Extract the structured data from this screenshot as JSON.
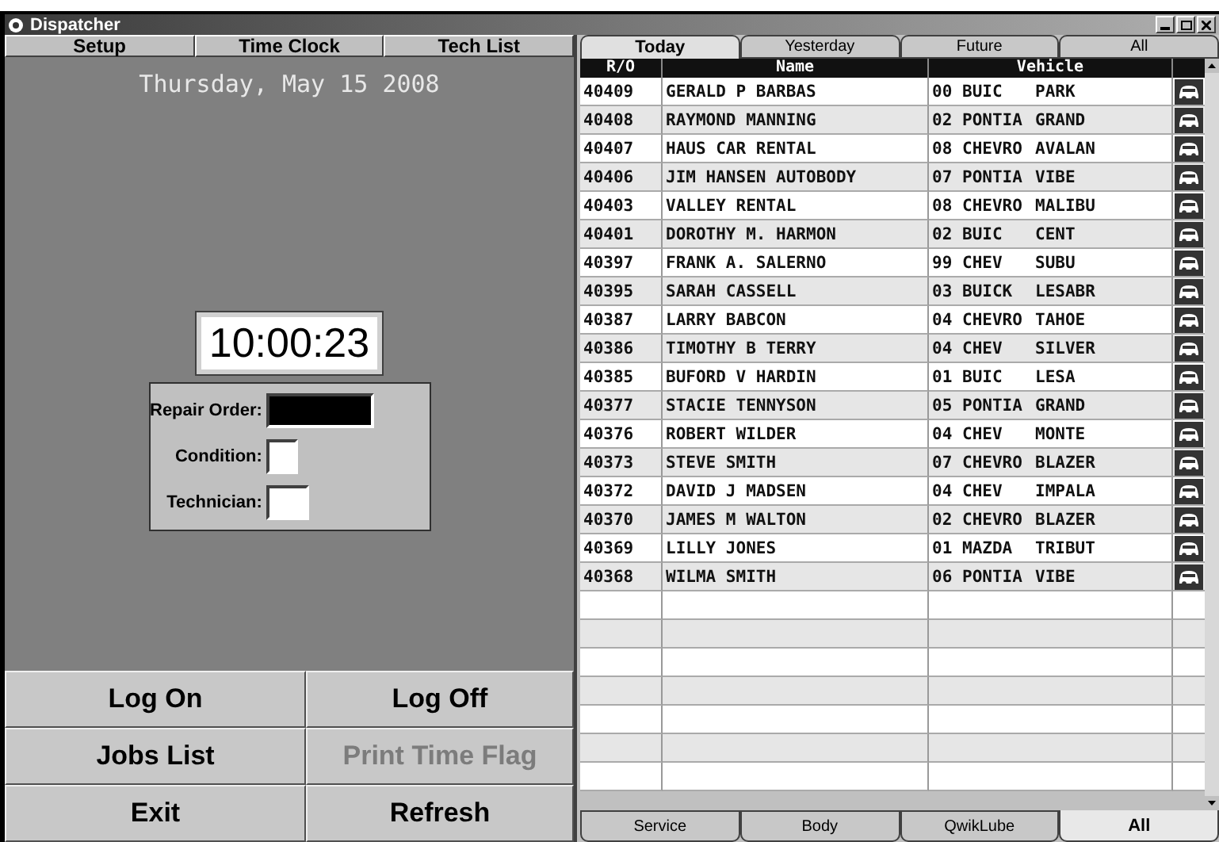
{
  "window": {
    "title": "Dispatcher"
  },
  "top_buttons": [
    "Setup",
    "Time Clock",
    "Tech List"
  ],
  "date": "Thursday, May 15 2008",
  "clock": "10:00:23",
  "form": {
    "fields": [
      {
        "label": "Repair Order:",
        "kind": "wide",
        "filled": true
      },
      {
        "label": "Condition:",
        "kind": "narrow",
        "filled": false
      },
      {
        "label": "Technician:",
        "kind": "medium",
        "filled": false
      }
    ]
  },
  "action_buttons": [
    {
      "label": "Log On",
      "disabled": false
    },
    {
      "label": "Log Off",
      "disabled": false
    },
    {
      "label": "Jobs List",
      "disabled": false
    },
    {
      "label": "Print Time Flag",
      "disabled": true
    },
    {
      "label": "Exit",
      "disabled": false
    },
    {
      "label": "Refresh",
      "disabled": false
    }
  ],
  "day_tabs": [
    {
      "label": "Today",
      "selected": true
    },
    {
      "label": "Yesterday",
      "selected": false
    },
    {
      "label": "Future",
      "selected": false
    },
    {
      "label": "All",
      "selected": false
    }
  ],
  "table": {
    "columns": [
      "R/O",
      "Name",
      "Vehicle"
    ],
    "rows": [
      {
        "ro": "40409",
        "name": "GERALD P BARBAS",
        "year": "00",
        "make": "BUIC",
        "model": "PARK"
      },
      {
        "ro": "40408",
        "name": "RAYMOND MANNING",
        "year": "02",
        "make": "PONTIA",
        "model": "GRAND"
      },
      {
        "ro": "40407",
        "name": "HAUS CAR RENTAL",
        "year": "08",
        "make": "CHEVRO",
        "model": "AVALAN"
      },
      {
        "ro": "40406",
        "name": "JIM HANSEN AUTOBODY",
        "year": "07",
        "make": "PONTIA",
        "model": "VIBE"
      },
      {
        "ro": "40403",
        "name": "VALLEY RENTAL",
        "year": "08",
        "make": "CHEVRO",
        "model": "MALIBU"
      },
      {
        "ro": "40401",
        "name": "DOROTHY M. HARMON",
        "year": "02",
        "make": "BUIC",
        "model": "CENT"
      },
      {
        "ro": "40397",
        "name": "FRANK A. SALERNO",
        "year": "99",
        "make": "CHEV",
        "model": "SUBU"
      },
      {
        "ro": "40395",
        "name": "SARAH CASSELL",
        "year": "03",
        "make": "BUICK",
        "model": "LESABR"
      },
      {
        "ro": "40387",
        "name": "LARRY BABCON",
        "year": "04",
        "make": "CHEVRO",
        "model": "TAHOE"
      },
      {
        "ro": "40386",
        "name": "TIMOTHY B TERRY",
        "year": "04",
        "make": "CHEV",
        "model": "SILVER"
      },
      {
        "ro": "40385",
        "name": "BUFORD V HARDIN",
        "year": "01",
        "make": "BUIC",
        "model": "LESA"
      },
      {
        "ro": "40377",
        "name": "STACIE TENNYSON",
        "year": "05",
        "make": "PONTIA",
        "model": "GRAND"
      },
      {
        "ro": "40376",
        "name": "ROBERT WILDER",
        "year": "04",
        "make": "CHEV",
        "model": "MONTE"
      },
      {
        "ro": "40373",
        "name": "STEVE SMITH",
        "year": "07",
        "make": "CHEVRO",
        "model": "BLAZER"
      },
      {
        "ro": "40372",
        "name": "DAVID J MADSEN",
        "year": "04",
        "make": "CHEV",
        "model": "IMPALA"
      },
      {
        "ro": "40370",
        "name": "JAMES M WALTON",
        "year": "02",
        "make": "CHEVRO",
        "model": "BLAZER"
      },
      {
        "ro": "40369",
        "name": "LILLY JONES",
        "year": "01",
        "make": "MAZDA",
        "model": "TRIBUT"
      },
      {
        "ro": "40368",
        "name": "WILMA SMITH",
        "year": "06",
        "make": "PONTIA",
        "model": "VIBE"
      }
    ]
  },
  "dept_tabs": [
    {
      "label": "Service",
      "selected": false
    },
    {
      "label": "Body",
      "selected": false
    },
    {
      "label": "QwikLube",
      "selected": false
    },
    {
      "label": "All",
      "selected": true
    }
  ]
}
